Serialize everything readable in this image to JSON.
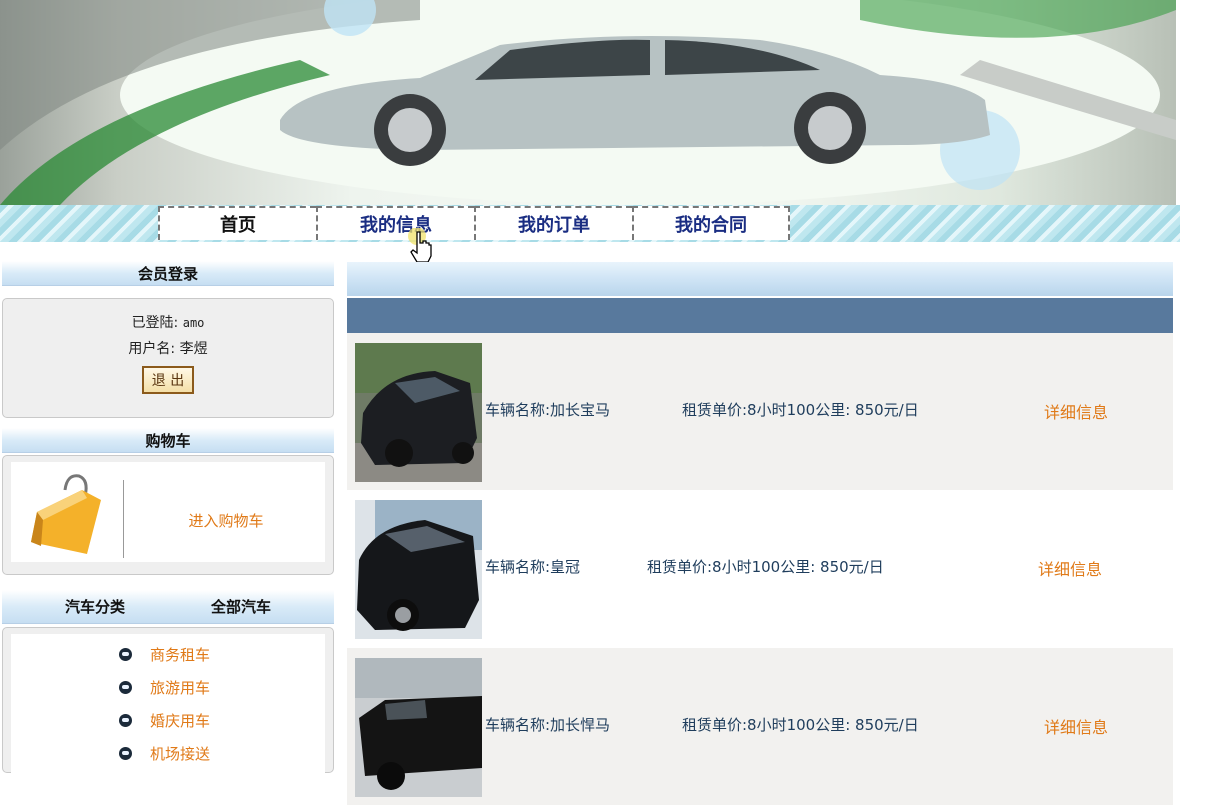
{
  "nav": {
    "tabs": [
      {
        "label": "首页"
      },
      {
        "label": "我的信息"
      },
      {
        "label": "我的订单"
      },
      {
        "label": "我的合同"
      }
    ]
  },
  "sidebar": {
    "login": {
      "title": "会员登录",
      "logged_in_label": "已登陆:",
      "logged_in_value": "amo",
      "username_label": "用户名:",
      "username_value": "李煜",
      "logout_label": "退 出"
    },
    "cart": {
      "title": "购物车",
      "link_label": "进入购物车",
      "icon": "shopping-bag-icon"
    },
    "categories": {
      "title": "汽车分类",
      "all_label": "全部汽车",
      "items": [
        {
          "label": "商务租车"
        },
        {
          "label": "旅游用车"
        },
        {
          "label": "婚庆用车"
        },
        {
          "label": "机场接送"
        }
      ]
    }
  },
  "cars": [
    {
      "name": "车辆名称:加长宝马",
      "price": "租赁单价:8小时100公里: 850元/日",
      "detail": "详细信息"
    },
    {
      "name": "车辆名称:皇冠",
      "price": "租赁单价:8小时100公里: 850元/日",
      "detail": "详细信息"
    },
    {
      "name": "车辆名称:加长悍马",
      "price": "租赁单价:8小时100公里: 850元/日",
      "detail": "详细信息"
    }
  ],
  "colors": {
    "nav_text": "#1a2d82",
    "link_orange": "#e07a18",
    "header_bar": "#58799d",
    "row_alt": "#f2f1ef"
  }
}
